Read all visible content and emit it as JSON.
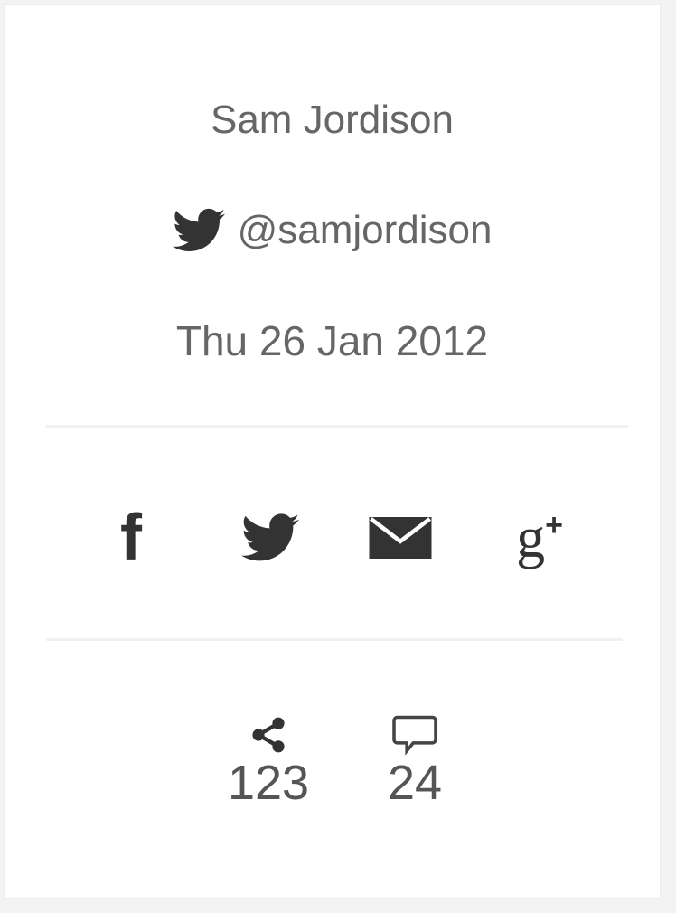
{
  "author": {
    "name": "Sam Jordison",
    "twitter_handle": "@samjordison",
    "twitter_icon": "twitter-bird-icon"
  },
  "article": {
    "date": "Thu 26 Jan 2012"
  },
  "share": {
    "facebook_glyph": "f",
    "facebook_icon": "facebook-icon",
    "twitter_icon": "twitter-bird-icon",
    "email_icon": "envelope-icon",
    "gplus_glyph": "g",
    "gplus_plus": "+",
    "gplus_icon": "google-plus-icon"
  },
  "stats": {
    "shares_icon": "share-icon",
    "shares_count": "123",
    "comments_icon": "speech-bubble-icon",
    "comments_count": "24"
  },
  "colors": {
    "text": "#666666",
    "icon": "#333333",
    "divider": "#f1f1f1",
    "background": "#ffffff",
    "page": "#f3f3f3"
  }
}
